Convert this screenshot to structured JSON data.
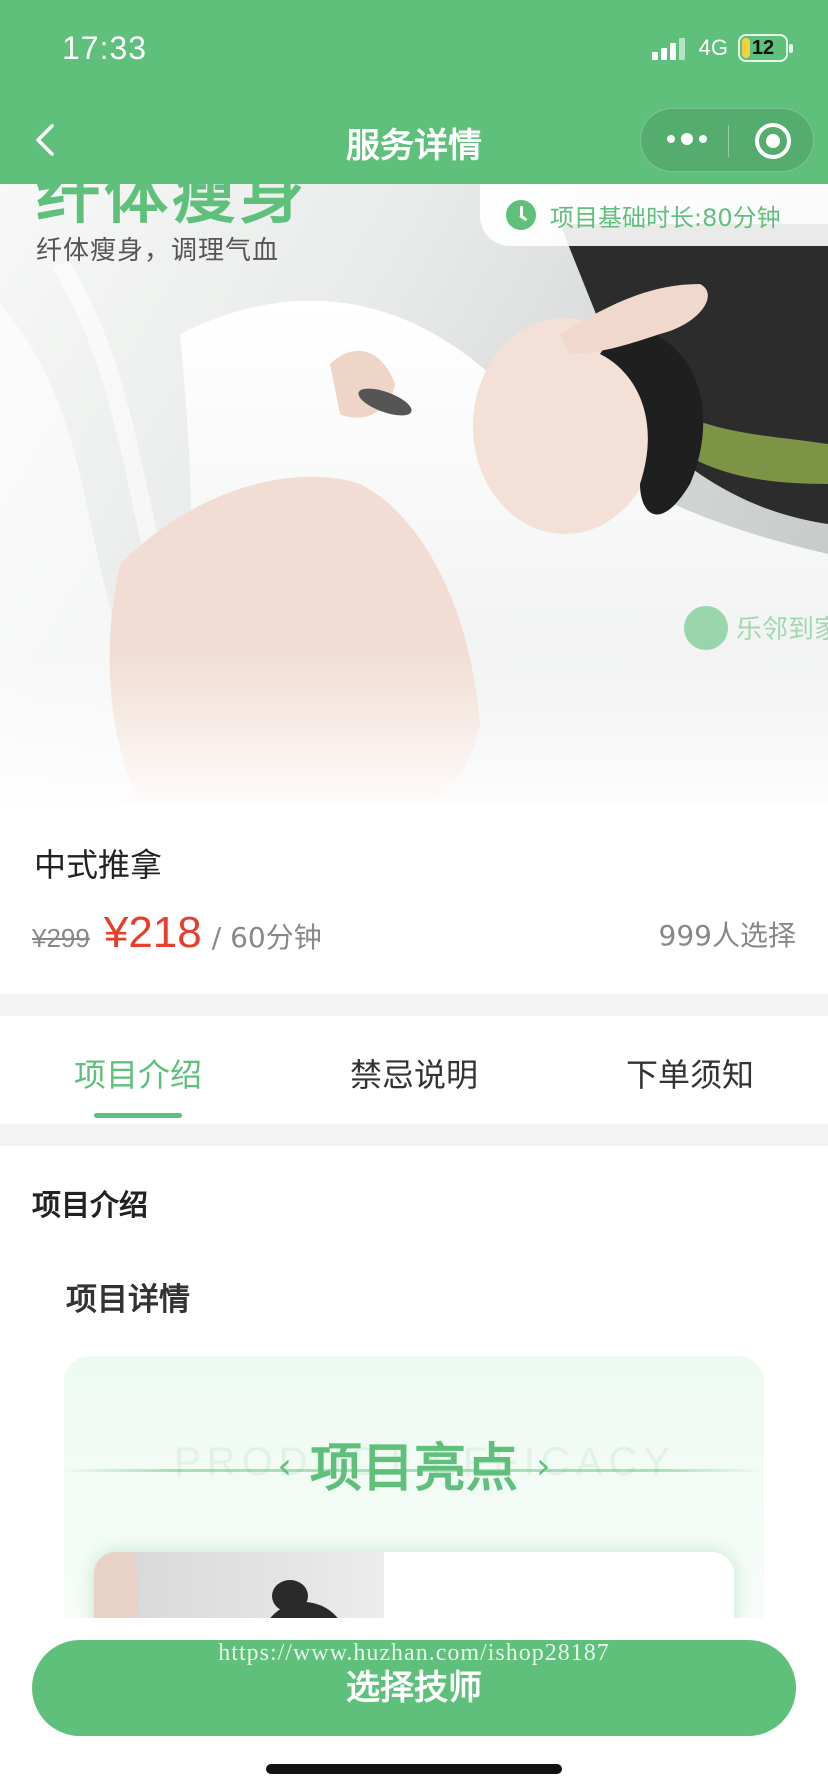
{
  "status_bar": {
    "time": "17:33",
    "network": "4G",
    "battery": "12"
  },
  "nav": {
    "title": "服务详情"
  },
  "hero": {
    "big_title": "纤体瘦身",
    "subtitle": "纤体瘦身，调理气血",
    "duration": "项目基础时长:80分钟"
  },
  "product": {
    "name": "中式推拿",
    "original_price": "¥299",
    "sale_price": "¥218",
    "unit": "/ 60分钟",
    "choose_count": "999人选择"
  },
  "tabs": [
    {
      "label": "项目介绍",
      "active": true
    },
    {
      "label": "禁忌说明",
      "active": false
    },
    {
      "label": "下单须知",
      "active": false
    }
  ],
  "content": {
    "section_title": "项目介绍",
    "sub_title": "项目详情",
    "poster_title": "项目亮点",
    "poster_ghost": "PRODUCT EFFICACY"
  },
  "cta": {
    "label": "选择技师",
    "watermark": "https://www.huzhan.com/ishop28187"
  },
  "colors": {
    "primary": "#5fc07c",
    "price": "#e3402f"
  }
}
